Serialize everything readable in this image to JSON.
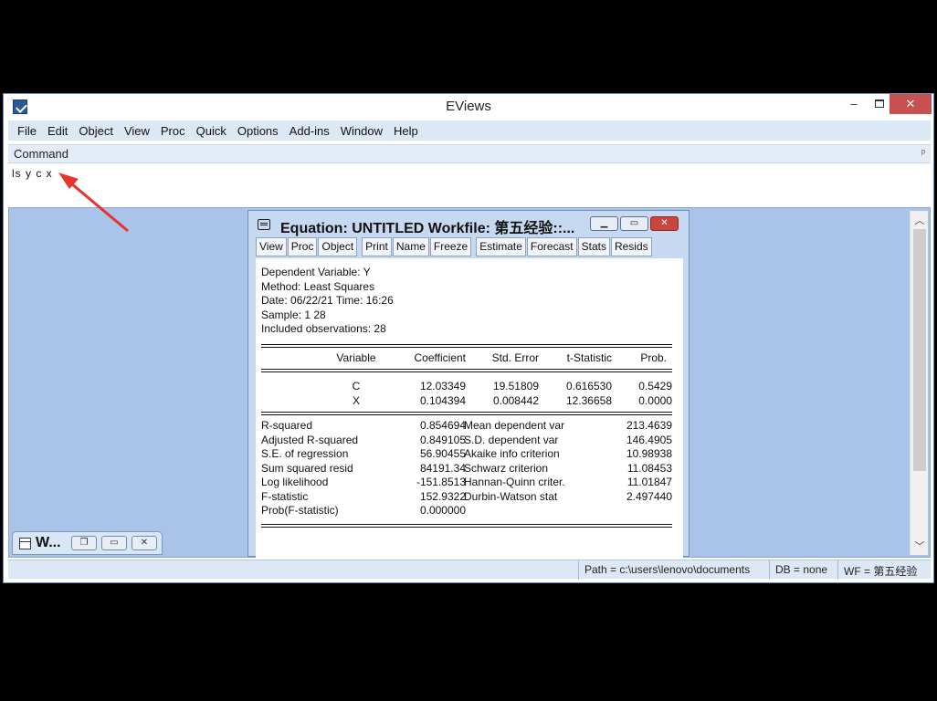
{
  "app": {
    "title": "EViews"
  },
  "window_controls": {
    "minimize": "–",
    "close": "✕"
  },
  "menu": [
    "File",
    "Edit",
    "Object",
    "View",
    "Proc",
    "Quick",
    "Options",
    "Add-ins",
    "Window",
    "Help"
  ],
  "command": {
    "label": "Command",
    "text": "ls y c x"
  },
  "mini_window": {
    "title": "W..."
  },
  "equation_window": {
    "title": "Equation: UNTITLED   Workfile: 第五经验::...",
    "toolbar_group1": [
      "View",
      "Proc",
      "Object"
    ],
    "toolbar_group2": [
      "Print",
      "Name",
      "Freeze"
    ],
    "toolbar_group3": [
      "Estimate",
      "Forecast",
      "Stats",
      "Resids"
    ],
    "header_lines": [
      "Dependent Variable: Y",
      "Method: Least Squares",
      "Date: 06/22/21   Time: 16:26",
      "Sample: 1 28",
      "Included observations: 28"
    ],
    "coef_columns": [
      "Variable",
      "Coefficient",
      "Std. Error",
      "t-Statistic",
      "Prob."
    ],
    "coefficients": [
      {
        "variable": "C",
        "coefficient": "12.03349",
        "std_error": "19.51809",
        "t_stat": "0.616530",
        "prob": "0.5429"
      },
      {
        "variable": "X",
        "coefficient": "0.104394",
        "std_error": "0.008442",
        "t_stat": "12.36658",
        "prob": "0.0000"
      }
    ],
    "stats": [
      {
        "label": "R-squared",
        "value": "0.854694",
        "label2": "Mean dependent var",
        "value2": "213.4639"
      },
      {
        "label": "Adjusted R-squared",
        "value": "0.849105",
        "label2": "S.D. dependent var",
        "value2": "146.4905"
      },
      {
        "label": "S.E. of regression",
        "value": "56.90455",
        "label2": "Akaike info criterion",
        "value2": "10.98938"
      },
      {
        "label": "Sum squared resid",
        "value": "84191.34",
        "label2": "Schwarz criterion",
        "value2": "11.08453"
      },
      {
        "label": "Log likelihood",
        "value": "-151.8513",
        "label2": "Hannan-Quinn criter.",
        "value2": "11.01847"
      },
      {
        "label": "F-statistic",
        "value": "152.9322",
        "label2": "Durbin-Watson stat",
        "value2": "2.497440"
      },
      {
        "label": "Prob(F-statistic)",
        "value": "0.000000",
        "label2": "",
        "value2": ""
      }
    ]
  },
  "status": {
    "path": "Path = c:\\users\\lenovo\\documents",
    "db": "DB = none",
    "wf": "WF = 第五经验"
  },
  "colors": {
    "workspace": "#a9c4e8",
    "menubar": "#dde8f6",
    "close_button": "#c75050",
    "annotation_arrow": "#e8332a"
  }
}
